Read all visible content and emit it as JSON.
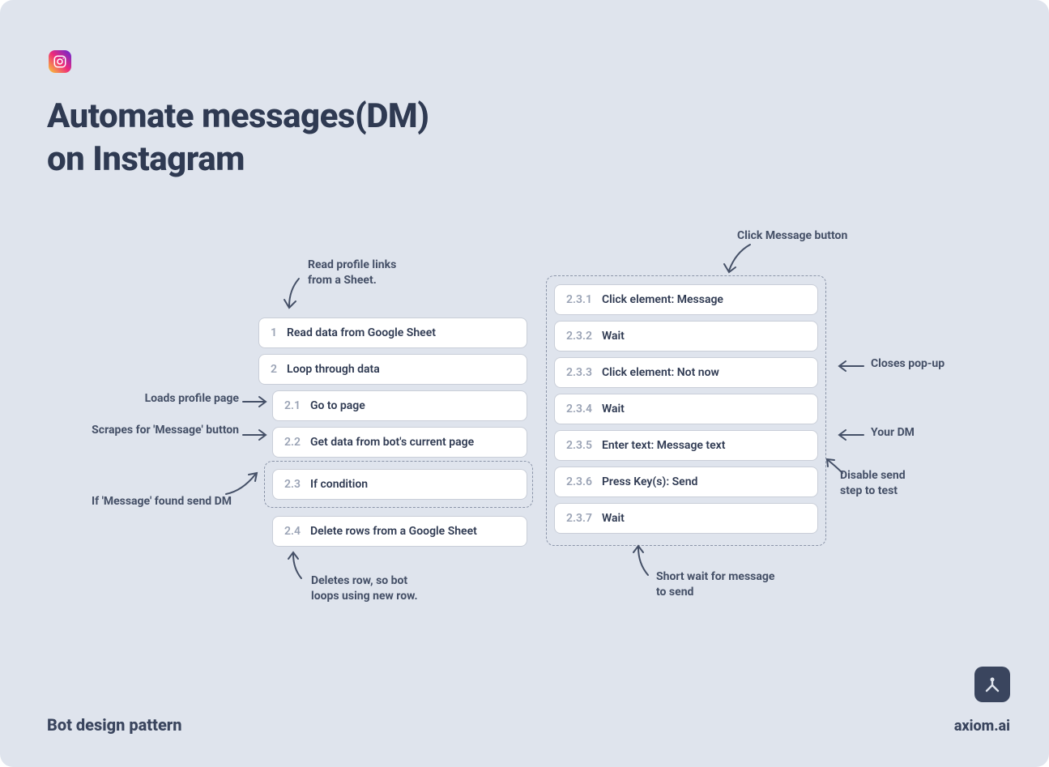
{
  "title_line1": "Automate messages(DM)",
  "title_line2": "on Instagram",
  "footer_left": "Bot design pattern",
  "footer_right": "axiom.ai",
  "left_steps": [
    {
      "num": "1",
      "label": "Read data from Google Sheet"
    },
    {
      "num": "2",
      "label": "Loop through data"
    },
    {
      "num": "2.1",
      "label": "Go to page"
    },
    {
      "num": "2.2",
      "label": "Get data from bot's current page"
    },
    {
      "num": "2.3",
      "label": "If condition"
    },
    {
      "num": "2.4",
      "label": "Delete rows from a Google Sheet"
    }
  ],
  "right_steps": [
    {
      "num": "2.3.1",
      "label": "Click element: Message"
    },
    {
      "num": "2.3.2",
      "label": "Wait"
    },
    {
      "num": "2.3.3",
      "label": "Click element: Not now"
    },
    {
      "num": "2.3.4",
      "label": "Wait"
    },
    {
      "num": "2.3.5",
      "label": "Enter text: Message text"
    },
    {
      "num": "2.3.6",
      "label": "Press Key(s): Send"
    },
    {
      "num": "2.3.7",
      "label": "Wait"
    }
  ],
  "annotations": {
    "read_profile": "Read profile links\nfrom a Sheet.",
    "click_message": "Click Message button",
    "loads_profile": "Loads profile page",
    "scrapes_message": "Scrapes for 'Message' button",
    "if_message_found": "If 'Message' found send DM",
    "closes_popup": "Closes pop-up",
    "your_dm": "Your DM",
    "disable_send": "Disable send\nstep to test",
    "deletes_row": "Deletes row, so bot\nloops using new row.",
    "short_wait": "Short wait for message\nto send"
  }
}
